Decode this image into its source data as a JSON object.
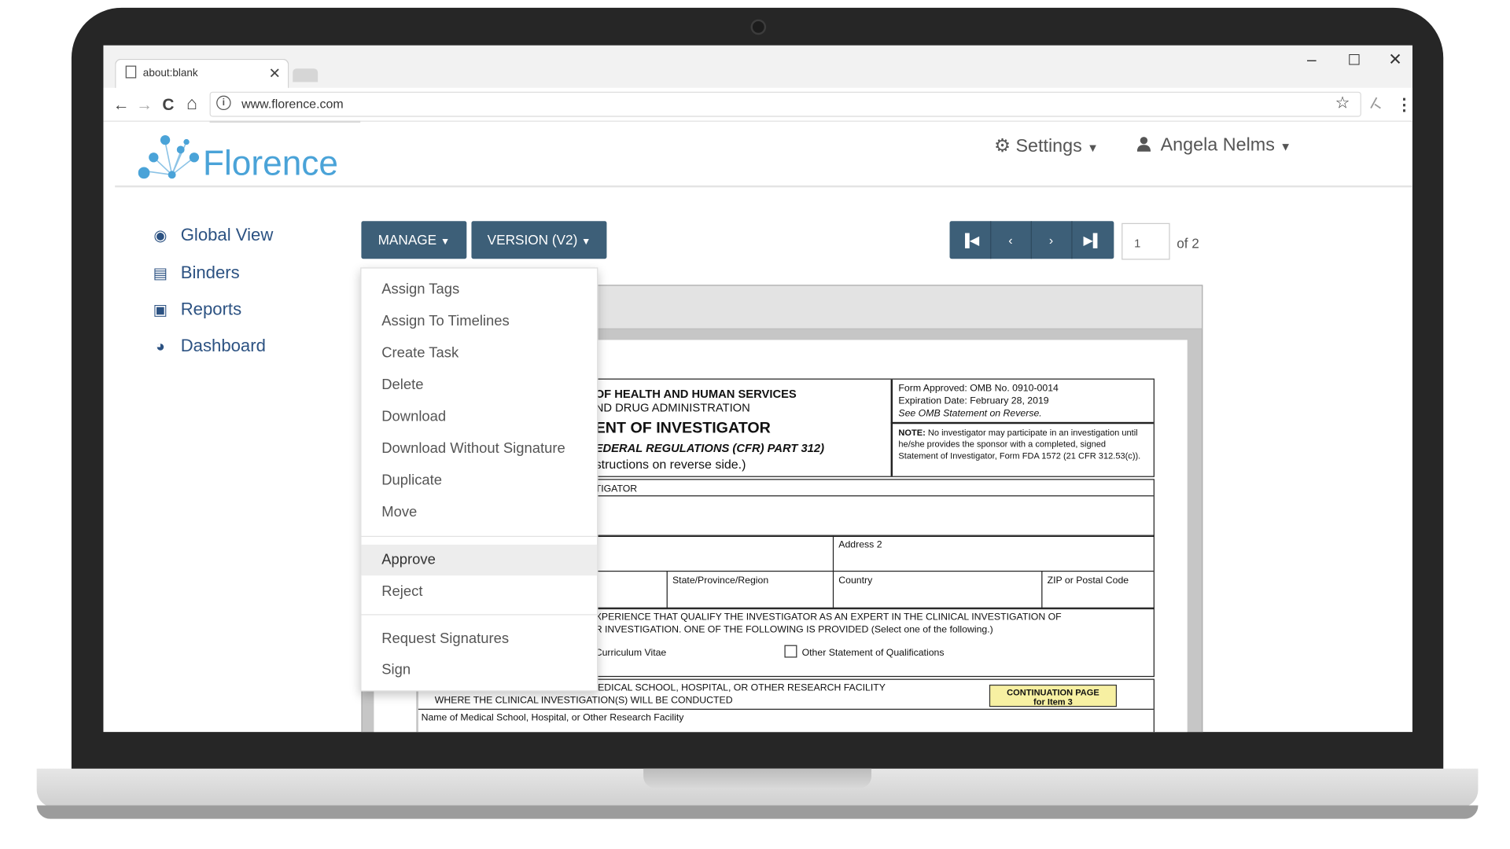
{
  "browser": {
    "tab_title": "about:blank",
    "tab_close": "✕",
    "url": "www.florence.com",
    "window_controls": {
      "minimize": "–",
      "maximize": "☐",
      "close": "✕"
    },
    "nav_icons": {
      "back": "←",
      "forward": "→",
      "reload": "C",
      "home": "⌂",
      "star": "☆",
      "menu": "⋮"
    }
  },
  "app": {
    "logo_text": "Florence",
    "settings_label": "Settings",
    "user_name": "Angela Nelms",
    "accent_color": "#3d5f78",
    "logo_color": "#4aa3d8"
  },
  "sidebar": {
    "items": [
      {
        "label": "Global View",
        "icon": "globe-icon"
      },
      {
        "label": "Binders",
        "icon": "binder-icon"
      },
      {
        "label": "Reports",
        "icon": "report-icon"
      },
      {
        "label": "Dashboard",
        "icon": "dashboard-icon"
      }
    ]
  },
  "toolbar": {
    "manage_label": "MANAGE",
    "version_label": "VERSION (V2)",
    "page_value": "1",
    "page_of": "of 2"
  },
  "manage_menu": {
    "items": [
      "Assign Tags",
      "Assign To Timelines",
      "Create Task",
      "Delete",
      "Download",
      "Download Without Signature",
      "Duplicate",
      "Move",
      "Approve",
      "Reject",
      "Request Signatures",
      "Sign"
    ],
    "highlighted": "Approve"
  },
  "document": {
    "dept": "OF HEALTH AND HUMAN SERVICES",
    "agency": "ND DRUG ADMINISTRATION",
    "title": "ENT OF INVESTIGATOR",
    "regs": "EDERAL REGULATIONS (CFR) PART 312)",
    "instructions": "structions on reverse side.)",
    "omb": "Form Approved: OMB No. 0910-0014",
    "expiration": "Expiration Date: February 28, 2019",
    "omb_statement": "See OMB Statement on Reverse.",
    "note_label": "NOTE:",
    "note_text": "No investigator may participate in an investigation until he/she provides the sponsor with a completed, signed Statement of Investigator, Form FDA 1572 (21 CFR 312.53(c)).",
    "investigator": "TIGATOR",
    "address2": "Address 2",
    "state": "State/Province/Region",
    "country": "Country",
    "zip": "ZIP or Postal Code",
    "experience_1": "XPERIENCE THAT QUALIFY THE INVESTIGATOR AS AN EXPERT IN THE CLINICAL INVESTIGATION OF",
    "experience_2": "R INVESTIGATION. ONE OF THE FOLLOWING IS PROVIDED (Select one of the following.)",
    "cv": "Curriculum Vitae",
    "other_statement": "Other Statement of Qualifications",
    "school_1": "IEDICAL SCHOOL, HOSPITAL, OR OTHER RESEARCH FACILITY",
    "school_2": "WHERE THE CLINICAL INVESTIGATION(S) WILL BE CONDUCTED",
    "continuation_1": "CONTINUATION PAGE",
    "continuation_2": "for Item 3",
    "school_name": "Name of Medical School, Hospital, or Other Research Facility"
  }
}
